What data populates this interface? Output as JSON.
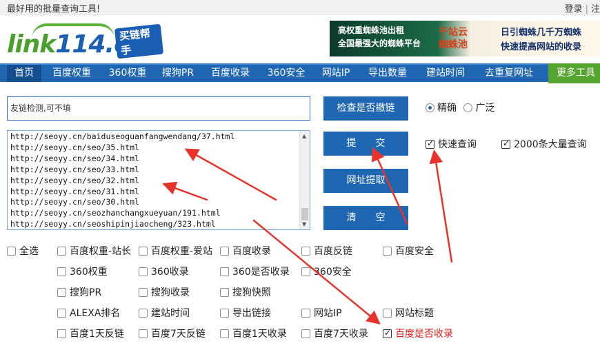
{
  "topbar": {
    "slogan": "最好用的批量查询工具!",
    "login": "登录",
    "register": "注"
  },
  "logo": {
    "text_main": "link",
    "text_num": "114",
    "text_tld": ".cn",
    "badge": "买链帮手"
  },
  "banner": {
    "left_line1": "高权重蜘蛛池出租",
    "left_line2": "全国最强大的蜘蛛平台",
    "brand_line1": "千站云",
    "brand_line2": "蜘蛛池",
    "right_line1": "日引蜘蛛几千万蜘蛛",
    "right_line2": "快速提高网站的收录"
  },
  "nav": {
    "items": [
      "首页",
      "百度权重",
      "360权重",
      "搜狗PR",
      "百度收录",
      "360安全",
      "网站IP",
      "导出数量",
      "建站时间",
      "去重复网址"
    ],
    "more": "更多工具"
  },
  "form": {
    "friend_value": "友链检测,可不填",
    "urls": [
      "http://seoyy.cn/baiduseoguanfangwendang/37.html",
      "http://seoyy.cn/seo/35.html",
      "http://seoyy.cn/seo/34.html",
      "http://seoyy.cn/seo/33.html",
      "http://seoyy.cn/seo/32.html",
      "http://seoyy.cn/seo/31.html",
      "http://seoyy.cn/seo/30.html",
      "http://seoyy.cn/seozhanchangxueyuan/191.html",
      "http://seoyy.cn/seoshipinjiaocheng/323.html"
    ],
    "check_button": "检查是否撤链",
    "submit_button": "提　　交",
    "extract_button": "网址提取",
    "clear_button": "清　　空",
    "radio_exact": "精确",
    "radio_broad": "广泛",
    "fast_query": "快速查询",
    "bulk_query": "2000条大量查询"
  },
  "options": {
    "select_all": "全选",
    "row1": [
      "百度权重-站长",
      "百度权重-爱站",
      "百度收录",
      "百度反链",
      "百度安全"
    ],
    "row2": [
      "360权重",
      "360收录",
      "360是否收录",
      "360安全"
    ],
    "row3": [
      "搜狗PR",
      "搜狗收录",
      "搜狗快照"
    ],
    "row4": [
      "ALEXA排名",
      "建站时间",
      "导出链接",
      "网站IP",
      "网站标题"
    ],
    "row5": [
      "百度1天反链",
      "百度7天反链",
      "百度1天收录",
      "百度7天收录",
      "百度是否收录"
    ]
  },
  "colors": {
    "nav_blue": "#1f67b2",
    "more_green": "#55a530",
    "annotation_red": "#e8332b"
  }
}
